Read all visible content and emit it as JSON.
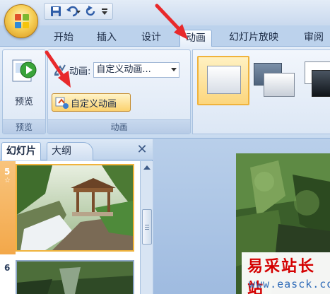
{
  "quick_access": {
    "icons": [
      "save-icon",
      "undo-icon",
      "redo-icon",
      "customize-icon"
    ]
  },
  "tabs": [
    {
      "label": "开始",
      "active": false
    },
    {
      "label": "插入",
      "active": false
    },
    {
      "label": "设计",
      "active": false
    },
    {
      "label": "动画",
      "active": true
    },
    {
      "label": "幻灯片放映",
      "active": false
    },
    {
      "label": "审阅",
      "active": false
    }
  ],
  "ribbon": {
    "preview_group": {
      "button_label": "预览",
      "group_label": "预览"
    },
    "animation_group": {
      "anim_label": "动画:",
      "anim_value": "自定义动画...",
      "custom_button": "自定义动画",
      "group_label": "动画"
    }
  },
  "left_pane": {
    "tab_slides": "幻灯片",
    "tab_outline": "大纲",
    "close_glyph": "✕",
    "slides": [
      {
        "number": "5",
        "selected": true
      },
      {
        "number": "6",
        "selected": false
      }
    ]
  },
  "watermark": {
    "text": "易采站长站",
    "url": "www.easck.com"
  },
  "colors": {
    "accent": "#f0b33c",
    "arrow": "#e8292b",
    "ribbon": "#dce7f5"
  }
}
